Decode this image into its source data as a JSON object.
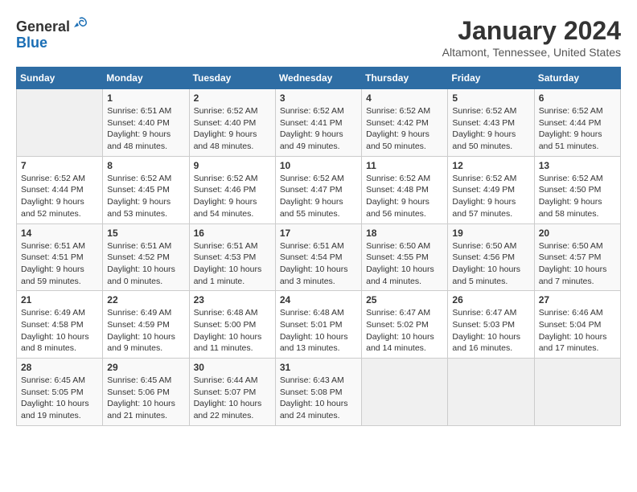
{
  "header": {
    "logo_general": "General",
    "logo_blue": "Blue",
    "title": "January 2024",
    "subtitle": "Altamont, Tennessee, United States"
  },
  "weekdays": [
    "Sunday",
    "Monday",
    "Tuesday",
    "Wednesday",
    "Thursday",
    "Friday",
    "Saturday"
  ],
  "weeks": [
    [
      {
        "day": "",
        "sunrise": "",
        "sunset": "",
        "daylight": ""
      },
      {
        "day": "1",
        "sunrise": "Sunrise: 6:51 AM",
        "sunset": "Sunset: 4:40 PM",
        "daylight": "Daylight: 9 hours and 48 minutes."
      },
      {
        "day": "2",
        "sunrise": "Sunrise: 6:52 AM",
        "sunset": "Sunset: 4:40 PM",
        "daylight": "Daylight: 9 hours and 48 minutes."
      },
      {
        "day": "3",
        "sunrise": "Sunrise: 6:52 AM",
        "sunset": "Sunset: 4:41 PM",
        "daylight": "Daylight: 9 hours and 49 minutes."
      },
      {
        "day": "4",
        "sunrise": "Sunrise: 6:52 AM",
        "sunset": "Sunset: 4:42 PM",
        "daylight": "Daylight: 9 hours and 50 minutes."
      },
      {
        "day": "5",
        "sunrise": "Sunrise: 6:52 AM",
        "sunset": "Sunset: 4:43 PM",
        "daylight": "Daylight: 9 hours and 50 minutes."
      },
      {
        "day": "6",
        "sunrise": "Sunrise: 6:52 AM",
        "sunset": "Sunset: 4:44 PM",
        "daylight": "Daylight: 9 hours and 51 minutes."
      }
    ],
    [
      {
        "day": "7",
        "sunrise": "Sunrise: 6:52 AM",
        "sunset": "Sunset: 4:44 PM",
        "daylight": "Daylight: 9 hours and 52 minutes."
      },
      {
        "day": "8",
        "sunrise": "Sunrise: 6:52 AM",
        "sunset": "Sunset: 4:45 PM",
        "daylight": "Daylight: 9 hours and 53 minutes."
      },
      {
        "day": "9",
        "sunrise": "Sunrise: 6:52 AM",
        "sunset": "Sunset: 4:46 PM",
        "daylight": "Daylight: 9 hours and 54 minutes."
      },
      {
        "day": "10",
        "sunrise": "Sunrise: 6:52 AM",
        "sunset": "Sunset: 4:47 PM",
        "daylight": "Daylight: 9 hours and 55 minutes."
      },
      {
        "day": "11",
        "sunrise": "Sunrise: 6:52 AM",
        "sunset": "Sunset: 4:48 PM",
        "daylight": "Daylight: 9 hours and 56 minutes."
      },
      {
        "day": "12",
        "sunrise": "Sunrise: 6:52 AM",
        "sunset": "Sunset: 4:49 PM",
        "daylight": "Daylight: 9 hours and 57 minutes."
      },
      {
        "day": "13",
        "sunrise": "Sunrise: 6:52 AM",
        "sunset": "Sunset: 4:50 PM",
        "daylight": "Daylight: 9 hours and 58 minutes."
      }
    ],
    [
      {
        "day": "14",
        "sunrise": "Sunrise: 6:51 AM",
        "sunset": "Sunset: 4:51 PM",
        "daylight": "Daylight: 9 hours and 59 minutes."
      },
      {
        "day": "15",
        "sunrise": "Sunrise: 6:51 AM",
        "sunset": "Sunset: 4:52 PM",
        "daylight": "Daylight: 10 hours and 0 minutes."
      },
      {
        "day": "16",
        "sunrise": "Sunrise: 6:51 AM",
        "sunset": "Sunset: 4:53 PM",
        "daylight": "Daylight: 10 hours and 1 minute."
      },
      {
        "day": "17",
        "sunrise": "Sunrise: 6:51 AM",
        "sunset": "Sunset: 4:54 PM",
        "daylight": "Daylight: 10 hours and 3 minutes."
      },
      {
        "day": "18",
        "sunrise": "Sunrise: 6:50 AM",
        "sunset": "Sunset: 4:55 PM",
        "daylight": "Daylight: 10 hours and 4 minutes."
      },
      {
        "day": "19",
        "sunrise": "Sunrise: 6:50 AM",
        "sunset": "Sunset: 4:56 PM",
        "daylight": "Daylight: 10 hours and 5 minutes."
      },
      {
        "day": "20",
        "sunrise": "Sunrise: 6:50 AM",
        "sunset": "Sunset: 4:57 PM",
        "daylight": "Daylight: 10 hours and 7 minutes."
      }
    ],
    [
      {
        "day": "21",
        "sunrise": "Sunrise: 6:49 AM",
        "sunset": "Sunset: 4:58 PM",
        "daylight": "Daylight: 10 hours and 8 minutes."
      },
      {
        "day": "22",
        "sunrise": "Sunrise: 6:49 AM",
        "sunset": "Sunset: 4:59 PM",
        "daylight": "Daylight: 10 hours and 9 minutes."
      },
      {
        "day": "23",
        "sunrise": "Sunrise: 6:48 AM",
        "sunset": "Sunset: 5:00 PM",
        "daylight": "Daylight: 10 hours and 11 minutes."
      },
      {
        "day": "24",
        "sunrise": "Sunrise: 6:48 AM",
        "sunset": "Sunset: 5:01 PM",
        "daylight": "Daylight: 10 hours and 13 minutes."
      },
      {
        "day": "25",
        "sunrise": "Sunrise: 6:47 AM",
        "sunset": "Sunset: 5:02 PM",
        "daylight": "Daylight: 10 hours and 14 minutes."
      },
      {
        "day": "26",
        "sunrise": "Sunrise: 6:47 AM",
        "sunset": "Sunset: 5:03 PM",
        "daylight": "Daylight: 10 hours and 16 minutes."
      },
      {
        "day": "27",
        "sunrise": "Sunrise: 6:46 AM",
        "sunset": "Sunset: 5:04 PM",
        "daylight": "Daylight: 10 hours and 17 minutes."
      }
    ],
    [
      {
        "day": "28",
        "sunrise": "Sunrise: 6:45 AM",
        "sunset": "Sunset: 5:05 PM",
        "daylight": "Daylight: 10 hours and 19 minutes."
      },
      {
        "day": "29",
        "sunrise": "Sunrise: 6:45 AM",
        "sunset": "Sunset: 5:06 PM",
        "daylight": "Daylight: 10 hours and 21 minutes."
      },
      {
        "day": "30",
        "sunrise": "Sunrise: 6:44 AM",
        "sunset": "Sunset: 5:07 PM",
        "daylight": "Daylight: 10 hours and 22 minutes."
      },
      {
        "day": "31",
        "sunrise": "Sunrise: 6:43 AM",
        "sunset": "Sunset: 5:08 PM",
        "daylight": "Daylight: 10 hours and 24 minutes."
      },
      {
        "day": "",
        "sunrise": "",
        "sunset": "",
        "daylight": ""
      },
      {
        "day": "",
        "sunrise": "",
        "sunset": "",
        "daylight": ""
      },
      {
        "day": "",
        "sunrise": "",
        "sunset": "",
        "daylight": ""
      }
    ]
  ]
}
